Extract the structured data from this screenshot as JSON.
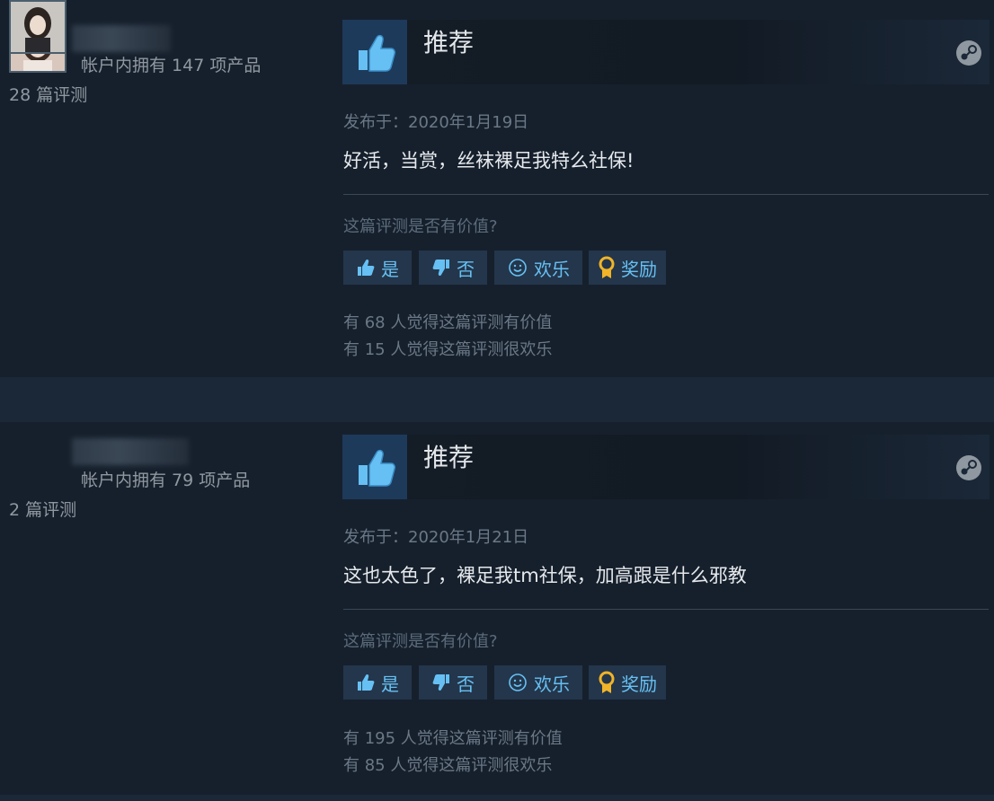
{
  "reviews": [
    {
      "owned": "帐户内拥有 147 项产品",
      "review_count": "28 篇评测",
      "recommend": "推荐",
      "posted": "发布于：2020年1月19日",
      "text": "好活，当赏，丝袜裸足我特么社保!",
      "helpful_question": "这篇评测是否有价值?",
      "buttons": {
        "yes": "是",
        "no": "否",
        "funny": "欢乐",
        "award": "奖励"
      },
      "helpful_stat": "有 68 人觉得这篇评测有价值",
      "funny_stat": "有 15 人觉得这篇评测很欢乐"
    },
    {
      "owned": "帐户内拥有 79 项产品",
      "review_count": "2 篇评测",
      "recommend": "推荐",
      "posted": "发布于：2020年1月21日",
      "text": "这也太色了，裸足我tm社保，加高跟是什么邪教",
      "helpful_question": "这篇评测是否有价值?",
      "buttons": {
        "yes": "是",
        "no": "否",
        "funny": "欢乐",
        "award": "奖励"
      },
      "helpful_stat": "有 195 人觉得这篇评测有价值",
      "funny_stat": "有 85 人觉得这篇评测很欢乐"
    }
  ],
  "icons": {
    "recommend": "thumbs-up-icon",
    "platform": "steam-logo-icon",
    "yes": "thumbs-up-icon",
    "no": "thumbs-down-icon",
    "funny": "smiley-icon",
    "award": "award-ribbon-icon"
  },
  "colors": {
    "accent": "#66c0f4",
    "background": "#16202d",
    "award": "#f0b429"
  }
}
